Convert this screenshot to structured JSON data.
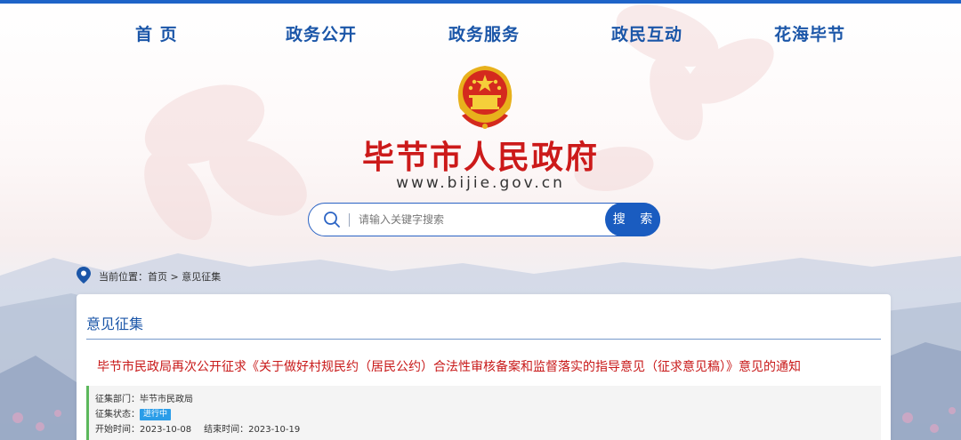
{
  "nav": {
    "items": [
      {
        "label": "首 页"
      },
      {
        "label": "政务公开"
      },
      {
        "label": "政务服务"
      },
      {
        "label": "政民互动"
      },
      {
        "label": "花海毕节"
      }
    ]
  },
  "header": {
    "site_title": "毕节市人民政府",
    "site_url": "www.bijie.gov.cn"
  },
  "search": {
    "placeholder": "请输入关键字搜索",
    "button_label": "搜 索"
  },
  "breadcrumb": {
    "prefix": "当前位置：",
    "home": "首页",
    "separator": " > ",
    "current": "意见征集"
  },
  "panel": {
    "title": "意见征集",
    "notice_title": "毕节市民政局再次公开征求《关于做好村规民约（居民公约）合法性审核备案和监督落实的指导意见（征求意见稿）》意见的通知",
    "dept_label": "征集部门：",
    "dept_value": "毕节市民政局",
    "status_label": "征集状态：",
    "status_value": "进行中",
    "start_label": "开始时间：",
    "start_value": "2023-10-08",
    "end_label": "结束时间：",
    "end_value": "2023-10-19"
  },
  "colors": {
    "brand_blue": "#1b56a8",
    "title_red": "#cc1a1a",
    "status_blue": "#2b9de8",
    "accent_green": "#5cb85c"
  }
}
